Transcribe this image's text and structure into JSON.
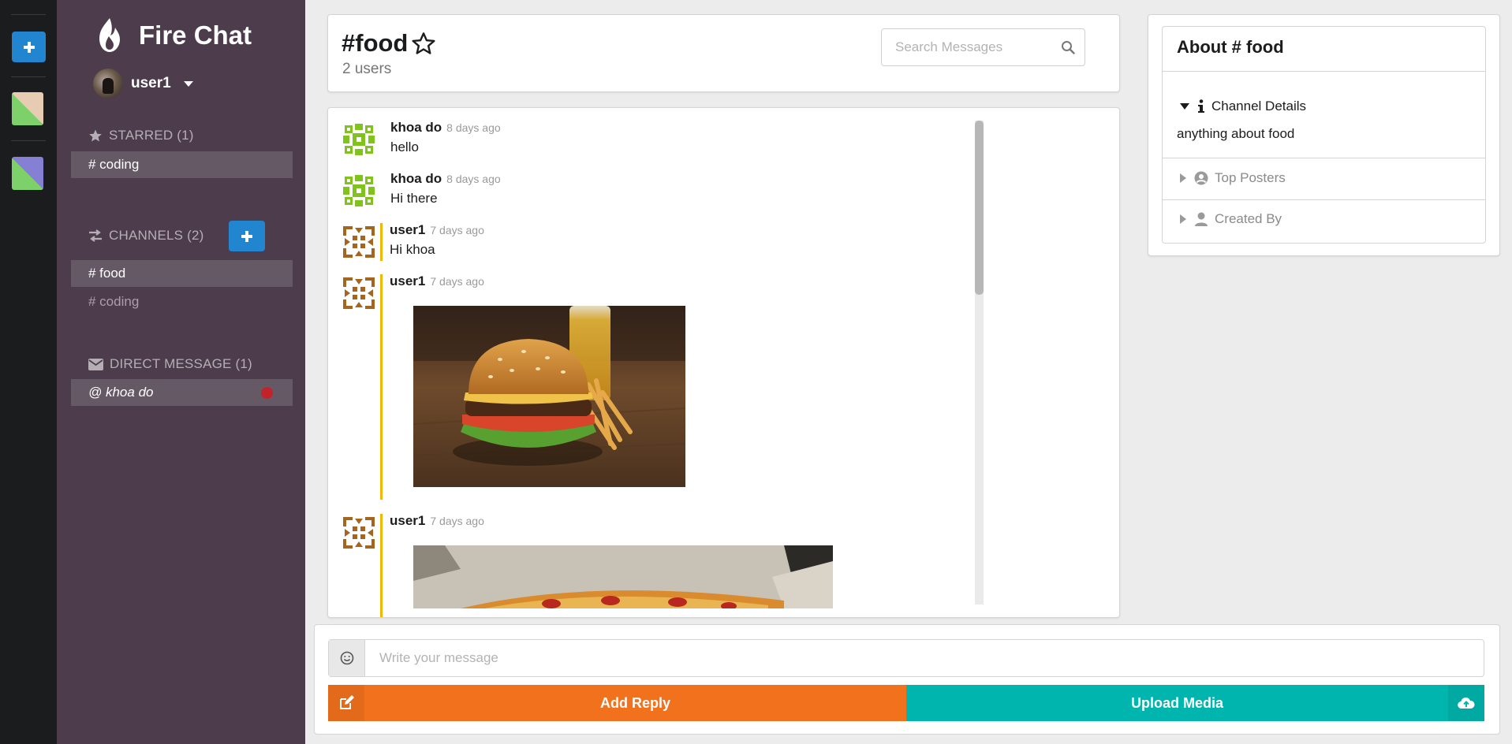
{
  "app": {
    "title": "Fire Chat"
  },
  "colors": {
    "sidebar": "#4c3c4c",
    "accent": "#2185d0",
    "add_reply": "#f2711c",
    "upload_media": "#00b5ad",
    "own_message_bar": "#f2b705",
    "notification": "#c2232b"
  },
  "color_bar": {
    "add_icon": "plus-icon",
    "swatches": [
      {
        "top": "#e8cbb3",
        "bottom": "#7ed06b"
      },
      {
        "top": "#8580d4",
        "bottom": "#7ed06b"
      }
    ]
  },
  "user": {
    "name": "user1"
  },
  "sidebar": {
    "starred": {
      "label": "STARRED (1)",
      "items": [
        {
          "label": "# coding"
        }
      ]
    },
    "channels": {
      "label": "CHANNELS (2)",
      "items": [
        {
          "label": "# food",
          "active": true
        },
        {
          "label": "# coding",
          "active": false
        }
      ]
    },
    "direct": {
      "label": "DIRECT MESSAGE (1)",
      "items": [
        {
          "label": "@ khoa do",
          "unread": true
        }
      ]
    }
  },
  "header": {
    "channel": "#food",
    "users": "2 users",
    "search_placeholder": "Search Messages"
  },
  "messages": [
    {
      "author": "khoa do",
      "time": "8 days ago",
      "text": "hello",
      "own": false,
      "avatar": "green-identicon"
    },
    {
      "author": "khoa do",
      "time": "8 days ago",
      "text": "Hi there",
      "own": false,
      "avatar": "green-identicon"
    },
    {
      "author": "user1",
      "time": "7 days ago",
      "text": "Hi khoa",
      "own": true,
      "avatar": "brown-identicon"
    },
    {
      "author": "user1",
      "time": "7 days ago",
      "text": "",
      "own": true,
      "avatar": "brown-identicon",
      "image": "burger-photo"
    },
    {
      "author": "user1",
      "time": "7 days ago",
      "text": "",
      "own": true,
      "avatar": "brown-identicon",
      "image": "pizza-photo"
    }
  ],
  "about": {
    "title": "About # food",
    "details_label": "Channel Details",
    "description": "anything about food",
    "top_posters_label": "Top Posters",
    "created_by_label": "Created By"
  },
  "composer": {
    "placeholder": "Write your message",
    "add_reply": "Add Reply",
    "upload_media": "Upload Media"
  }
}
